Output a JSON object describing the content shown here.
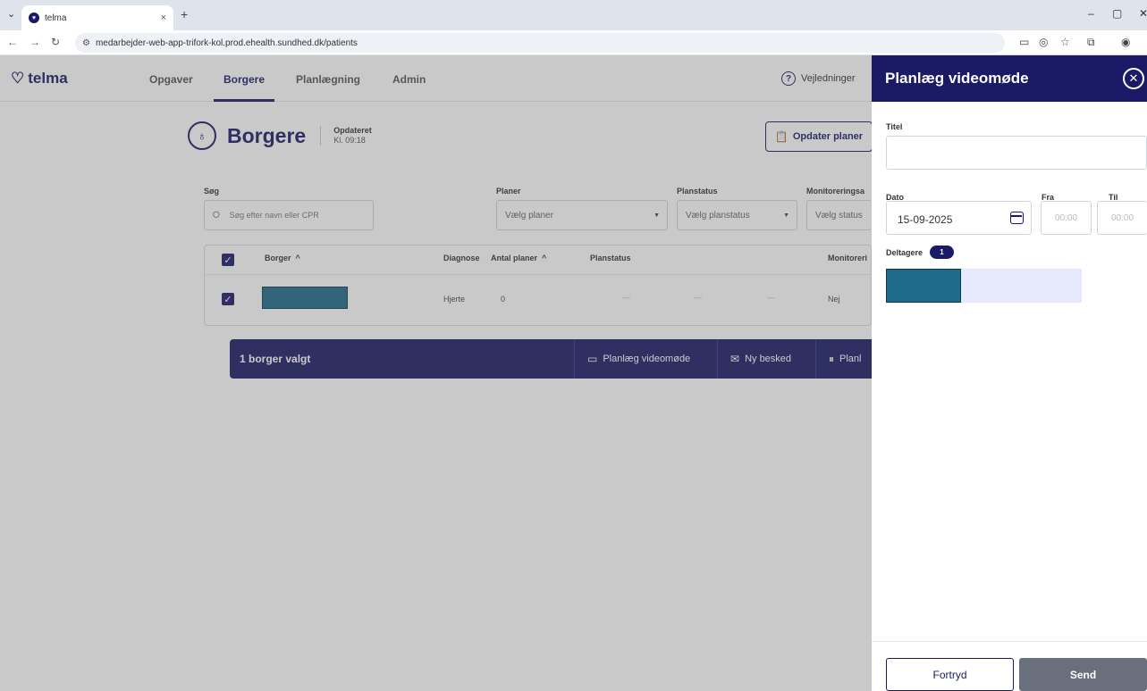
{
  "browser": {
    "tab_title": "telma",
    "new_tab": "+",
    "tab_close": "×",
    "url": "medarbejder-web-app-trifork-kol.prod.ehealth.sundhed.dk/patients"
  },
  "nav": {
    "logo": "telma",
    "items": [
      "Opgaver",
      "Borgere",
      "Planlægning",
      "Admin"
    ],
    "active": "Borgere",
    "help": "Vejledninger"
  },
  "page": {
    "title": "Borgere",
    "updated_label": "Opdateret",
    "updated_time": "Kl. 09:18",
    "update_button": "Opdater planer"
  },
  "filters": {
    "search_label": "Søg",
    "search_placeholder": "Søg efter navn eller CPR",
    "plans_label": "Planer",
    "plans_value": "Vælg planer",
    "planstatus_label": "Planstatus",
    "planstatus_value": "Vælg planstatus",
    "monitoring_label": "Monitoreringsa",
    "monitoring_value": "Vælg status"
  },
  "table": {
    "headers": {
      "borger": "Borger",
      "diagnose": "Diagnose",
      "antal": "Antal planer",
      "planstatus": "Planstatus",
      "monitorering": "Monitoreri"
    },
    "sort_arrow": "^",
    "rows": [
      {
        "diagnose": "Hjerte",
        "antal": "0",
        "dash": "—",
        "monitorering": "Nej"
      }
    ]
  },
  "actionbar": {
    "count": "1 borger valgt",
    "video": "Planlæg videomøde",
    "message": "Ny besked",
    "plan": "Planl"
  },
  "panel": {
    "title": "Planlæg videomøde",
    "titel_label": "Titel",
    "titel_value": "",
    "dato_label": "Dato",
    "dato_value": "15-09-2025",
    "fra_label": "Fra",
    "fra_placeholder": "00:00",
    "til_label": "Til",
    "til_placeholder": "00:00",
    "deltagere_label": "Deltagere",
    "deltagere_count": "1",
    "cancel": "Fortryd",
    "send": "Send"
  },
  "colors": {
    "brand": "#1a1a66",
    "redaction": "#1e6b8c",
    "send_disabled": "#6a6f7d"
  }
}
